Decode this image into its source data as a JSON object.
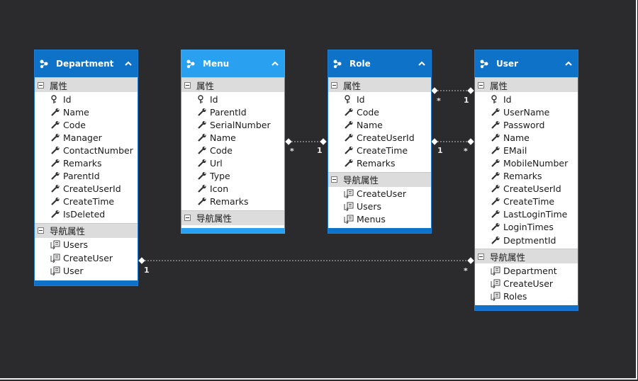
{
  "section_labels": {
    "props": "属性",
    "nav": "导航属性"
  },
  "entities": {
    "department": {
      "title": "Department",
      "props": [
        "Id",
        "Name",
        "Code",
        "Manager",
        "ContactNumber",
        "Remarks",
        "ParentId",
        "CreateUserId",
        "CreateTime",
        "IsDeleted"
      ],
      "nav": [
        "Users",
        "CreateUser",
        "User"
      ]
    },
    "menu": {
      "title": "Menu",
      "props": [
        "Id",
        "ParentId",
        "SerialNumber",
        "Name",
        "Code",
        "Url",
        "Type",
        "Icon",
        "Remarks"
      ],
      "nav": []
    },
    "role": {
      "title": "Role",
      "props": [
        "Id",
        "Code",
        "Name",
        "CreateUserId",
        "CreateTime",
        "Remarks"
      ],
      "nav": [
        "CreateUser",
        "Users",
        "Menus"
      ]
    },
    "user": {
      "title": "User",
      "props": [
        "Id",
        "UserName",
        "Password",
        "Name",
        "EMail",
        "MobileNumber",
        "Remarks",
        "CreateUserId",
        "CreateTime",
        "LastLoginTime",
        "LoginTimes",
        "DeptmentId"
      ],
      "nav": [
        "Department",
        "CreateUser",
        "Roles"
      ]
    }
  },
  "multiplicities": {
    "menu_role_menu": "*",
    "menu_role_role": "1",
    "role_user1_role": "*",
    "role_user1_user": "1",
    "role_user2_role": "1",
    "role_user2_user": "*",
    "dept_user_dept": "1",
    "dept_user_user": "*"
  },
  "colors": {
    "header_blue": "#0f72c9",
    "header_light_blue": "#2aa1f0",
    "section_gray": "#dcdcdc",
    "background": "#2b2b2d"
  }
}
